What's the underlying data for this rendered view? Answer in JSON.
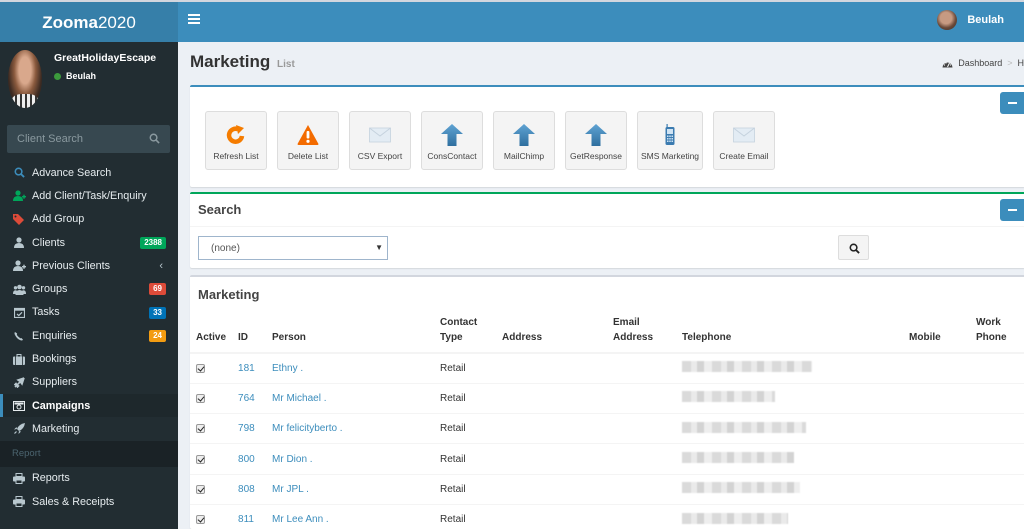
{
  "app": {
    "logo_bold": "Zooma",
    "logo_light": "2020"
  },
  "navbar": {
    "user_name": "Beulah"
  },
  "sidebar": {
    "company": "GreatHolidayEscape",
    "user_status": "Beulah",
    "search_placeholder": "Client Search",
    "items": [
      {
        "label": "Advance Search",
        "icon": "search-icon",
        "color": "#3c8dbc"
      },
      {
        "label": "Add Client/Task/Enquiry",
        "icon": "user-plus-icon",
        "color": "#00a65a"
      },
      {
        "label": "Add Group",
        "icon": "tag-icon",
        "color": "#dd4b39"
      },
      {
        "label": "Clients",
        "icon": "user-icon",
        "badge": "2388",
        "badge_color": "#00a65a"
      },
      {
        "label": "Previous Clients",
        "icon": "user-plus-icon",
        "chevron": "‹"
      },
      {
        "label": "Groups",
        "icon": "users-icon",
        "badge": "69",
        "badge_color": "#dd4b39"
      },
      {
        "label": "Tasks",
        "icon": "calendar-check-icon",
        "badge": "33",
        "badge_color": "#0073b7"
      },
      {
        "label": "Enquiries",
        "icon": "phone-icon",
        "badge": "24",
        "badge_color": "#f39c12"
      },
      {
        "label": "Bookings",
        "icon": "suitcase-icon"
      },
      {
        "label": "Suppliers",
        "icon": "plane-icon"
      },
      {
        "label": "Campaigns",
        "icon": "camera-icon",
        "active": true
      },
      {
        "label": "Marketing",
        "icon": "rocket-icon"
      }
    ],
    "report_header": "Report",
    "report_items": [
      {
        "label": "Reports",
        "icon": "print-icon"
      },
      {
        "label": "Sales & Receipts",
        "icon": "print-icon"
      }
    ]
  },
  "page": {
    "title": "Marketing",
    "subtitle": "List",
    "breadcrumb": [
      "Dashboard",
      "H"
    ]
  },
  "toolbar": {
    "buttons": [
      {
        "label": "Refresh List",
        "icon": "refresh-icon"
      },
      {
        "label": "Delete List",
        "icon": "warning-icon"
      },
      {
        "label": "CSV Export",
        "icon": "envelope-icon"
      },
      {
        "label": "ConsContact",
        "icon": "upload-arrow-icon"
      },
      {
        "label": "MailChimp",
        "icon": "upload-arrow-icon"
      },
      {
        "label": "GetResponse",
        "icon": "upload-arrow-icon"
      },
      {
        "label": "SMS Marketing",
        "icon": "mobile-phone-icon"
      },
      {
        "label": "Create Email",
        "icon": "envelope-icon"
      }
    ]
  },
  "search_box": {
    "title": "Search",
    "select_value": "(none)"
  },
  "marketing_table": {
    "title": "Marketing",
    "columns": [
      {
        "line1": "",
        "line2": "Active"
      },
      {
        "line1": "",
        "line2": "ID"
      },
      {
        "line1": "",
        "line2": "Person"
      },
      {
        "line1": "Contact",
        "line2": "Type"
      },
      {
        "line1": "",
        "line2": "Address"
      },
      {
        "line1": "Email",
        "line2": "Address"
      },
      {
        "line1": "",
        "line2": "Telephone"
      },
      {
        "line1": "",
        "line2": "Mobile"
      },
      {
        "line1": "Work",
        "line2": "Phone"
      }
    ],
    "rows": [
      {
        "active": true,
        "id": "181",
        "person": "Ethny .",
        "contact_type": "Retail",
        "address": "",
        "email": "",
        "telephone": "[redacted]",
        "mobile": "",
        "work_phone": ""
      },
      {
        "active": true,
        "id": "764",
        "person": "Mr Michael .",
        "contact_type": "Retail",
        "address": "",
        "email": "",
        "telephone": "[redacted]",
        "mobile": "",
        "work_phone": ""
      },
      {
        "active": true,
        "id": "798",
        "person": "Mr felicityberto .",
        "contact_type": "Retail",
        "address": "",
        "email": "",
        "telephone": "[redacted]",
        "mobile": "",
        "work_phone": ""
      },
      {
        "active": true,
        "id": "800",
        "person": "Mr Dion .",
        "contact_type": "Retail",
        "address": "",
        "email": "",
        "telephone": "[redacted]",
        "mobile": "",
        "work_phone": ""
      },
      {
        "active": true,
        "id": "808",
        "person": "Mr JPL .",
        "contact_type": "Retail",
        "address": "",
        "email": "",
        "telephone": "[redacted]",
        "mobile": "",
        "work_phone": ""
      },
      {
        "active": true,
        "id": "811",
        "person": "Mr Lee Ann .",
        "contact_type": "Retail",
        "address": "",
        "email": "",
        "telephone": "[redacted]",
        "mobile": "",
        "work_phone": ""
      }
    ]
  },
  "colors": {
    "primary": "#3c8dbc",
    "success": "#00a65a",
    "sidebar_bg": "#222d32"
  }
}
